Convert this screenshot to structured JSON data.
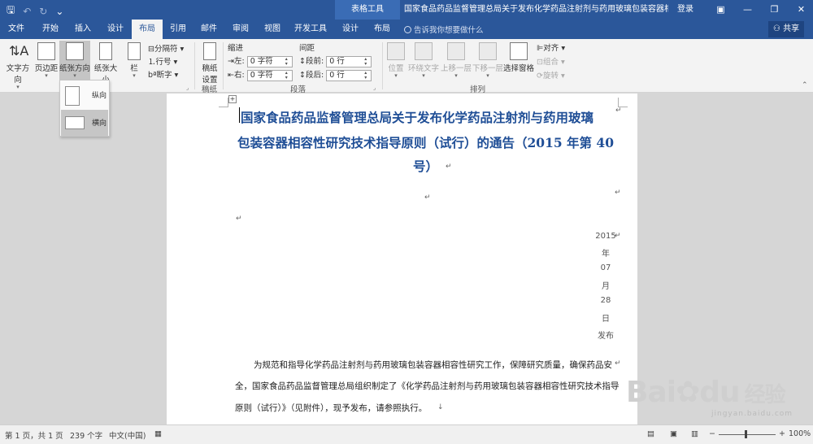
{
  "titlebar": {
    "table_tools": "表格工具",
    "doc_title": "国家食品药品监督管理总局关于发布化学药品注射剂与药用玻璃包装容器相容性研...",
    "login": "登录"
  },
  "tabs": [
    "文件",
    "开始",
    "插入",
    "设计",
    "布局",
    "引用",
    "邮件",
    "审阅",
    "视图",
    "开发工具",
    "设计",
    "布局"
  ],
  "active_tab": "布局",
  "tellme": "告诉我你想要做什么",
  "share": "共享",
  "ribbon": {
    "page_setup": {
      "text_direction": "文字方向",
      "margins": "页边距",
      "orientation": "纸张方向",
      "size": "纸张大小",
      "columns": "栏",
      "breaks": "分隔符",
      "line_numbers": "行号",
      "hyphenation": "断字"
    },
    "manuscript": {
      "label_line1": "稿纸",
      "label_line2": "设置",
      "group": "稿纸"
    },
    "paragraph": {
      "indent": "缩进",
      "spacing": "间距",
      "left_label": "左:",
      "left_value": "0 字符",
      "right_label": "右:",
      "right_value": "0 字符",
      "before_label": "段前:",
      "before_value": "0 行",
      "after_label": "段后:",
      "after_value": "0 行",
      "group": "段落"
    },
    "arrange": {
      "position": "位置",
      "wrap_text": "环绕文字",
      "bring_forward": "上移一层",
      "send_backward": "下移一层",
      "selection_pane": "选择窗格",
      "align": "对齐",
      "group_btn": "组合",
      "rotate": "旋转",
      "group": "排列"
    }
  },
  "orientation_menu": {
    "portrait": "纵向",
    "landscape": "横向"
  },
  "document": {
    "title_lines": [
      "国家食品药品监督管理总局关于发布化学药品注射剂与药用玻璃",
      "包装容器相容性研究技术指导原则（试行）的通告（2015 年第 40",
      "号）"
    ],
    "date_parts": [
      "2015",
      "年",
      "07",
      "月",
      "28",
      "日",
      "发布"
    ],
    "body_lines": [
      "为规范和指导化学药品注射剂与药用玻璃包装容器相容性研究工作，保障研究质量，确保药品安",
      "全，国家食品药品监督管理总局组织制定了《化学药品注射剂与药用玻璃包装容器相容性研究技术指导",
      "原则（试行）》（见附件），现予发布，请参照执行。"
    ]
  },
  "status": {
    "page": "第 1 页，共 1 页",
    "words": "239 个字",
    "lang": "中文(中国)",
    "zoom": "100%"
  },
  "watermark": {
    "brand": "Bai",
    "brand2": "du",
    "cn": "经验",
    "sub": "jingyan.baidu.com"
  }
}
